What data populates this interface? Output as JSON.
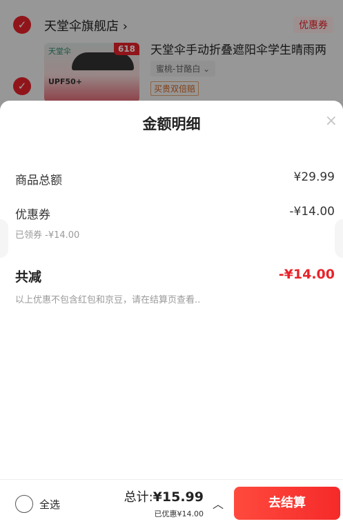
{
  "background": {
    "shop_name": "天堂伞旗舰店",
    "coupon_tag": "优惠券",
    "product": {
      "brand_mark": "天堂伞",
      "promo_badge": "618",
      "upf_text": "UPF50+",
      "title": "天堂伞手动折叠遮阳伞学生晴雨两",
      "variant": "蜜桃-甘酪白",
      "badge": "买贵双倍赔"
    }
  },
  "sheet": {
    "title": "金额明细",
    "close_glyph": "×",
    "rows": {
      "goods_total_label": "商品总额",
      "goods_total_value": "¥29.99",
      "coupon_label": "优惠券",
      "coupon_value": "-¥14.00",
      "coupon_sub": "已领券 -¥14.00",
      "total_reduction_label": "共减",
      "total_reduction_value": "-¥14.00"
    },
    "note": "以上优惠不包含红包和京豆，请在结算页查看.."
  },
  "bottom_bar": {
    "select_all": "全选",
    "sum_prefix": "总计:",
    "sum_amount": "¥15.99",
    "discount": "已优惠¥14.00",
    "checkout": "去结算"
  },
  "colors": {
    "accent": "#e8232a",
    "checkout_gradient_start": "#ff4a3d",
    "checkout_gradient_end": "#f52a2a"
  },
  "icons": {
    "check": "check-icon",
    "close": "close-icon",
    "chevron_up": "chevron-up-icon",
    "chevron_right": "chevron-right-icon",
    "chevron_down": "chevron-down-icon"
  }
}
